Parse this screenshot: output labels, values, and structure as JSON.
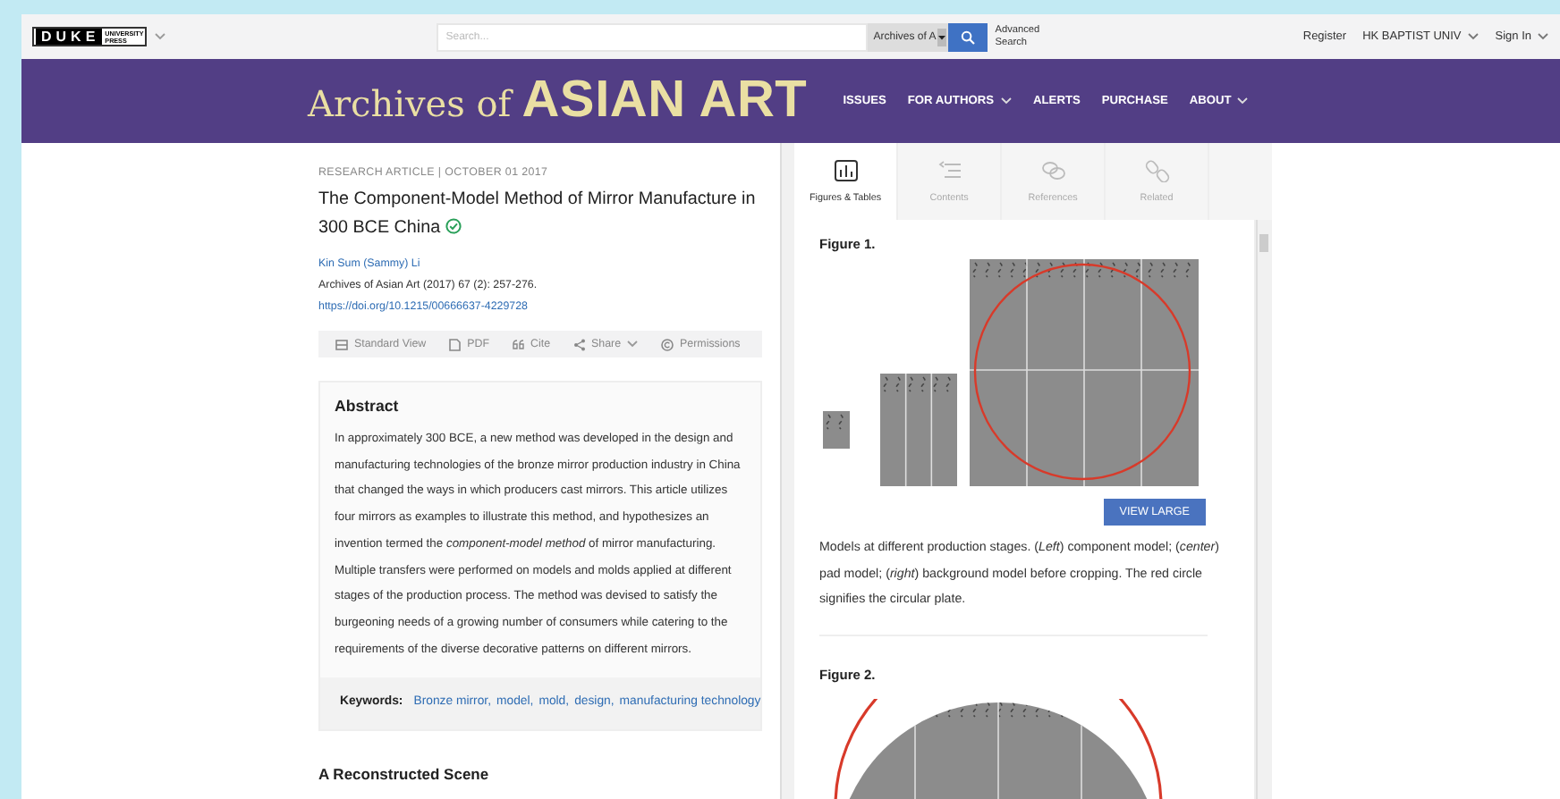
{
  "header": {
    "logo": {
      "wordmark": "DUKE",
      "line_1": "UNIVERSITY",
      "line_2": "PRESS"
    },
    "search": {
      "placeholder": "Search..."
    },
    "scope": "Archives of A",
    "advanced_search": "Advanced Search",
    "links": [
      {
        "label": "Register",
        "dropdown": false
      },
      {
        "label": "HK BAPTIST UNIV",
        "dropdown": true
      },
      {
        "label": "Sign In",
        "dropdown": true
      }
    ]
  },
  "banner": {
    "title_prefix": "Archives of",
    "title_main": "ASIAN ART",
    "nav": [
      {
        "label": "ISSUES",
        "dropdown": false
      },
      {
        "label": "FOR AUTHORS",
        "dropdown": true
      },
      {
        "label": "ALERTS",
        "dropdown": false
      },
      {
        "label": "PURCHASE",
        "dropdown": false
      },
      {
        "label": "ABOUT",
        "dropdown": true
      }
    ]
  },
  "article": {
    "meta": "RESEARCH ARTICLE | OCTOBER 01 2017",
    "title": "The Component-Model Method of Mirror Manufacture in 300 BCE China",
    "verified": true,
    "author": "Kin Sum (Sammy) Li",
    "citation": "Archives of Asian Art (2017) 67 (2): 257-276.",
    "doi": "https://doi.org/10.1215/00666637-4229728",
    "tools": [
      {
        "label": "Standard View",
        "kind": "view",
        "dropdown": false
      },
      {
        "label": "PDF",
        "kind": "pdf",
        "dropdown": false
      },
      {
        "label": "Cite",
        "kind": "cite",
        "dropdown": false
      },
      {
        "label": "Share",
        "kind": "share",
        "dropdown": true
      },
      {
        "label": "Permissions",
        "kind": "permissions",
        "dropdown": false
      }
    ],
    "abstract": {
      "heading": "Abstract",
      "text": "In approximately 300 BCE, a new method was developed in the design and manufacturing technologies of the bronze mirror production industry in China that changed the ways in which producers cast mirrors. This article utilizes four mirrors as examples to illustrate this method, and hypothesizes an invention termed the *component-model method* of mirror manufacturing. Multiple transfers were performed on models and molds applied at different stages of the production process. The method was devised to satisfy the burgeoning needs of a growing number of consumers while catering to the requirements of the diverse decorative patterns on different mirrors."
    },
    "keywords": {
      "label": "Keywords:",
      "items": [
        "Bronze mirror,",
        "model,",
        "mold,",
        "design,",
        "manufacturing technology"
      ]
    },
    "next_heading": "A Reconstructed Scene"
  },
  "panel": {
    "tabs": [
      {
        "label": "Figures & Tables",
        "kind": "figures",
        "selected": true
      },
      {
        "label": "Contents",
        "kind": "contents",
        "selected": false
      },
      {
        "label": "References",
        "kind": "references",
        "selected": false
      },
      {
        "label": "Related",
        "kind": "related",
        "selected": false
      }
    ],
    "figures": [
      {
        "label": "Figure 1.",
        "kind": "stages",
        "button": "VIEW LARGE",
        "caption": "Models at different production stages. (*Left*) component model; (*center*) pad model; (*right*) background model before cropping. The red circle signifies the circular plate."
      },
      {
        "label": "Figure 2.",
        "kind": "disc"
      }
    ]
  }
}
